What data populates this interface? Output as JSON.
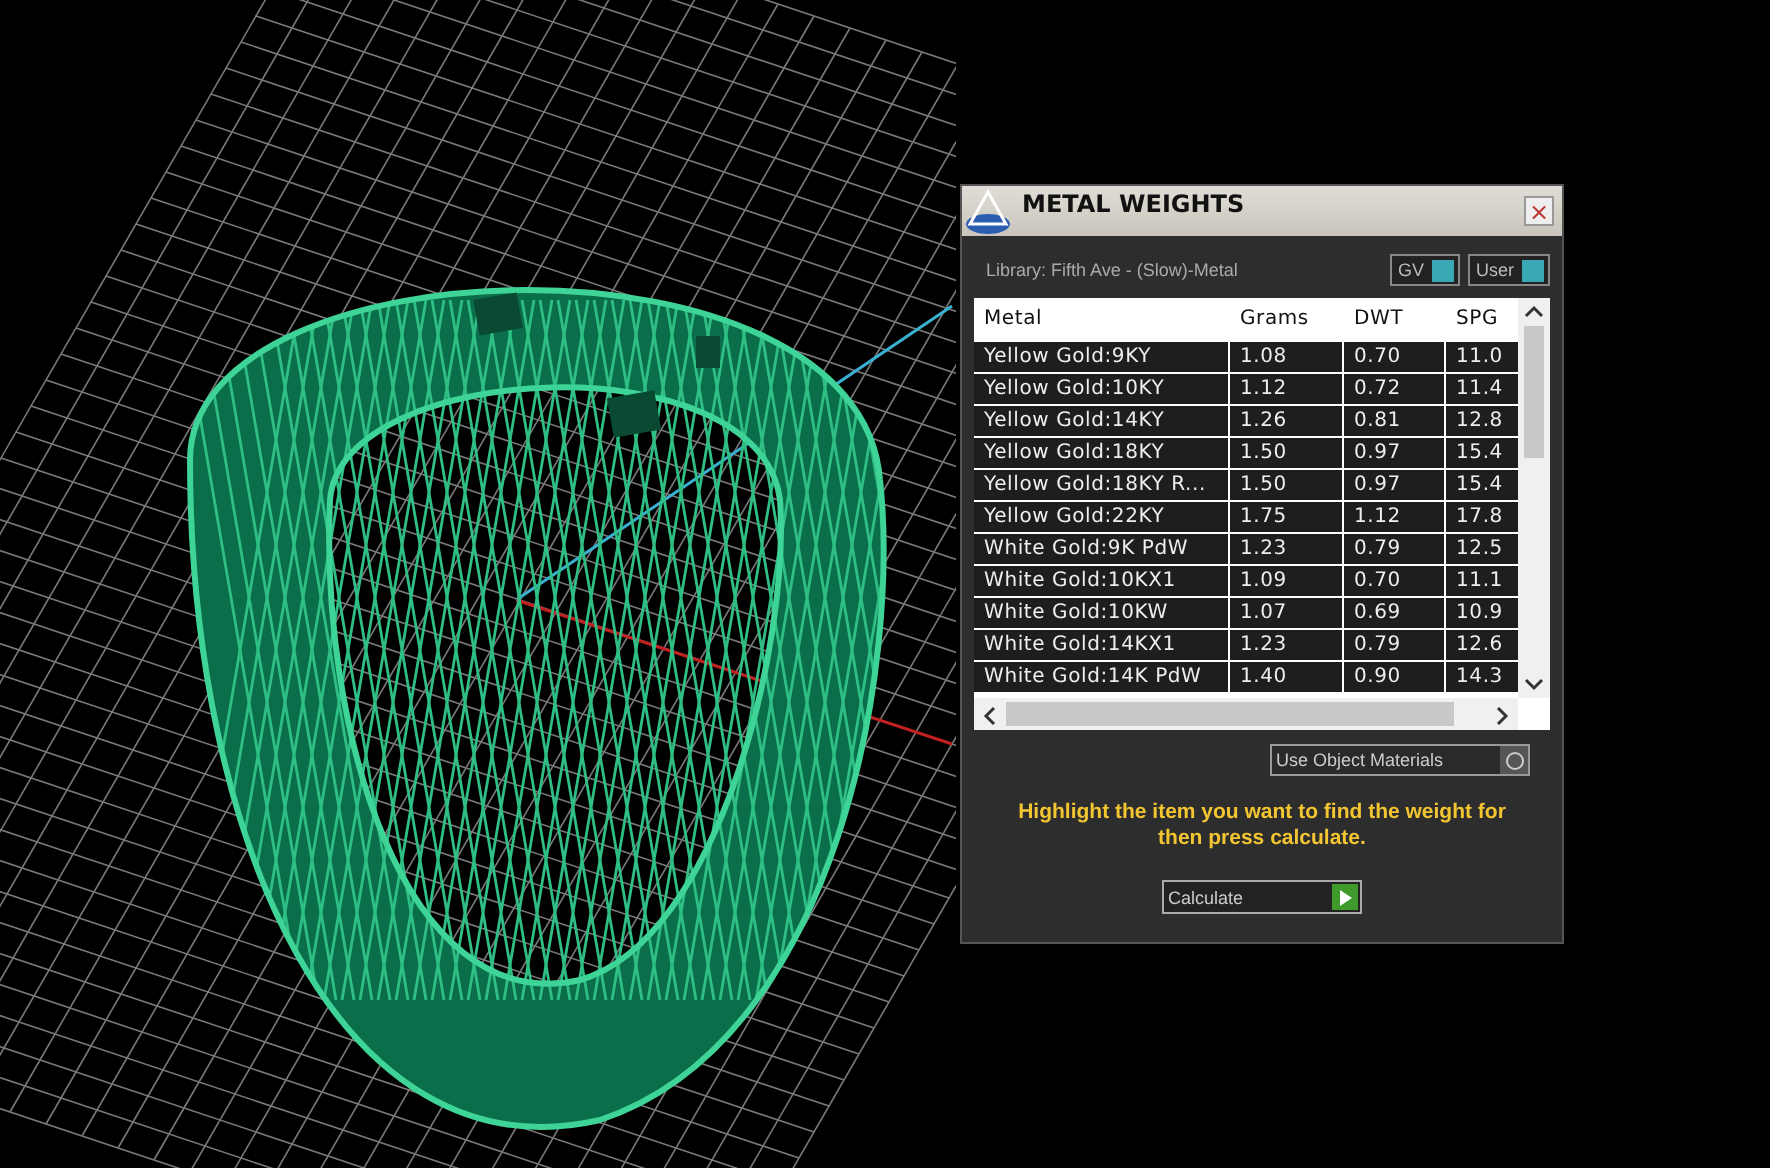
{
  "dialog": {
    "title": "METAL WEIGHTS",
    "close": "×",
    "library": "Library: Fifth Ave - (Slow)-Metal",
    "toggles": [
      {
        "label": "GV",
        "on": true
      },
      {
        "label": "User",
        "on": true
      }
    ],
    "table": {
      "columns": [
        "Metal",
        "Grams",
        "DWT",
        "SPG"
      ],
      "rows": [
        {
          "cells": [
            "Yellow Gold:9KY",
            "1.08",
            "0.70",
            "11.0"
          ]
        },
        {
          "cells": [
            "Yellow Gold:10KY",
            "1.12",
            "0.72",
            "11.4"
          ]
        },
        {
          "cells": [
            "Yellow Gold:14KY",
            "1.26",
            "0.81",
            "12.8"
          ]
        },
        {
          "cells": [
            "Yellow Gold:18KY",
            "1.50",
            "0.97",
            "15.4"
          ]
        },
        {
          "cells": [
            "Yellow Gold:18KY R...",
            "1.50",
            "0.97",
            "15.4"
          ]
        },
        {
          "cells": [
            "Yellow Gold:22KY",
            "1.75",
            "1.12",
            "17.8"
          ]
        },
        {
          "cells": [
            "White Gold:9K PdW",
            "1.23",
            "0.79",
            "12.5"
          ]
        },
        {
          "cells": [
            "White Gold:10KX1",
            "1.09",
            "0.70",
            "11.1"
          ]
        },
        {
          "cells": [
            "White Gold:10KW",
            "1.07",
            "0.69",
            "10.9"
          ]
        },
        {
          "cells": [
            "White Gold:14KX1",
            "1.23",
            "0.79",
            "12.6"
          ]
        },
        {
          "cells": [
            "White Gold:14K PdW",
            "1.40",
            "0.90",
            "14.3"
          ]
        }
      ]
    },
    "use_object_materials": {
      "label": "Use Object Materials",
      "on": false
    },
    "hint": "Highlight the item you want to find the weight for then press calculate.",
    "calculate": "Calculate"
  }
}
